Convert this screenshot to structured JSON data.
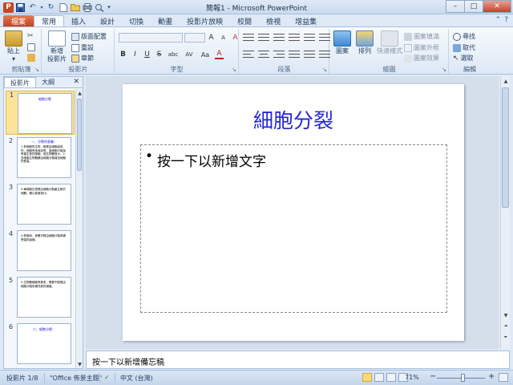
{
  "window": {
    "title": "簡報1 - Microsoft PowerPoint",
    "minimize": "–",
    "maximize": "□",
    "close": "✕"
  },
  "qat": {
    "app_logo": "P",
    "save": "💾",
    "undo": "↶",
    "redo": "↻",
    "new": "▢",
    "open": "📂",
    "print_preview": "🖶",
    "more": "▾"
  },
  "tabs": [
    "檔案",
    "常用",
    "插入",
    "設計",
    "切換",
    "動畫",
    "投影片放映",
    "校閱",
    "檢視",
    "增益集"
  ],
  "active_tab_index": 1,
  "ribbon": {
    "clipboard": {
      "label": "剪貼簿",
      "paste": "貼上",
      "paste_arrow": "▾"
    },
    "slides": {
      "label": "投影片",
      "new_slide": "新增",
      "new_slide2": "投影片",
      "layout": "版面配置",
      "reset": "重設",
      "section": "章節"
    },
    "font": {
      "label": "字型",
      "bold": "B",
      "italic": "I",
      "underline": "U",
      "strike": "S",
      "shadow": "abc",
      "spacing": "AV",
      "case": "Aa",
      "color": "A",
      "grow": "A",
      "shrink": "A",
      "clear": "A"
    },
    "paragraph": {
      "label": "段落"
    },
    "drawing": {
      "label": "繪圖",
      "shapes": "圖案",
      "arrange": "排列",
      "quick_styles": "快速樣式",
      "fill": "圖案填滿",
      "outline": "圖案外框",
      "effects": "圖案效果"
    },
    "editing": {
      "label": "編輯",
      "find": "尋找",
      "replace": "取代",
      "select": "選取"
    }
  },
  "left_pane": {
    "tab_slides": "投影片",
    "tab_outline": "大綱",
    "close": "✕",
    "thumbs": [
      {
        "num": "1",
        "title": "細胞分裂",
        "body": ""
      },
      {
        "num": "2",
        "title": "一、分裂的意義：",
        "body": "1.有細胞的生物，都是由細胞組成的，細胞會逐漸成長，當細胞分裂後會產生新的細胞，使生物體長大。2.多細胞生物體藉由細胞分裂增加細胞的數量。"
      },
      {
        "num": "3",
        "title": "",
        "body": "3.單細胞生物經由細胞分裂產生新的個體，藉以繁殖後代。"
      },
      {
        "num": "4",
        "title": "",
        "body": "4.受傷時，身體可經由細胞分裂修補受傷的組織。"
      },
      {
        "num": "5",
        "title": "",
        "body": "5.生物體細胞會衰老，需要不斷經由細胞分裂來補充新的細胞。"
      },
      {
        "num": "6",
        "title": "二、細胞分裂：",
        "body": ""
      }
    ]
  },
  "slide": {
    "title": "細胞分裂",
    "bullet": "•",
    "content_placeholder": "按一下以新增文字"
  },
  "notes": {
    "placeholder": "按一下以新增備忘稿"
  },
  "status": {
    "slide_position": "投影片 1/8",
    "theme": "\"Office 佈景主題\"",
    "spell_icon": "✓",
    "language": "中文 (台灣)",
    "zoom": "71%",
    "zoom_minus": "−",
    "zoom_plus": "+",
    "zoom_fraction": 0.55
  },
  "colors": {
    "file_tab": "#c4441c",
    "title_text": "#2525d6",
    "selected_thumb": "#fbe39a"
  }
}
